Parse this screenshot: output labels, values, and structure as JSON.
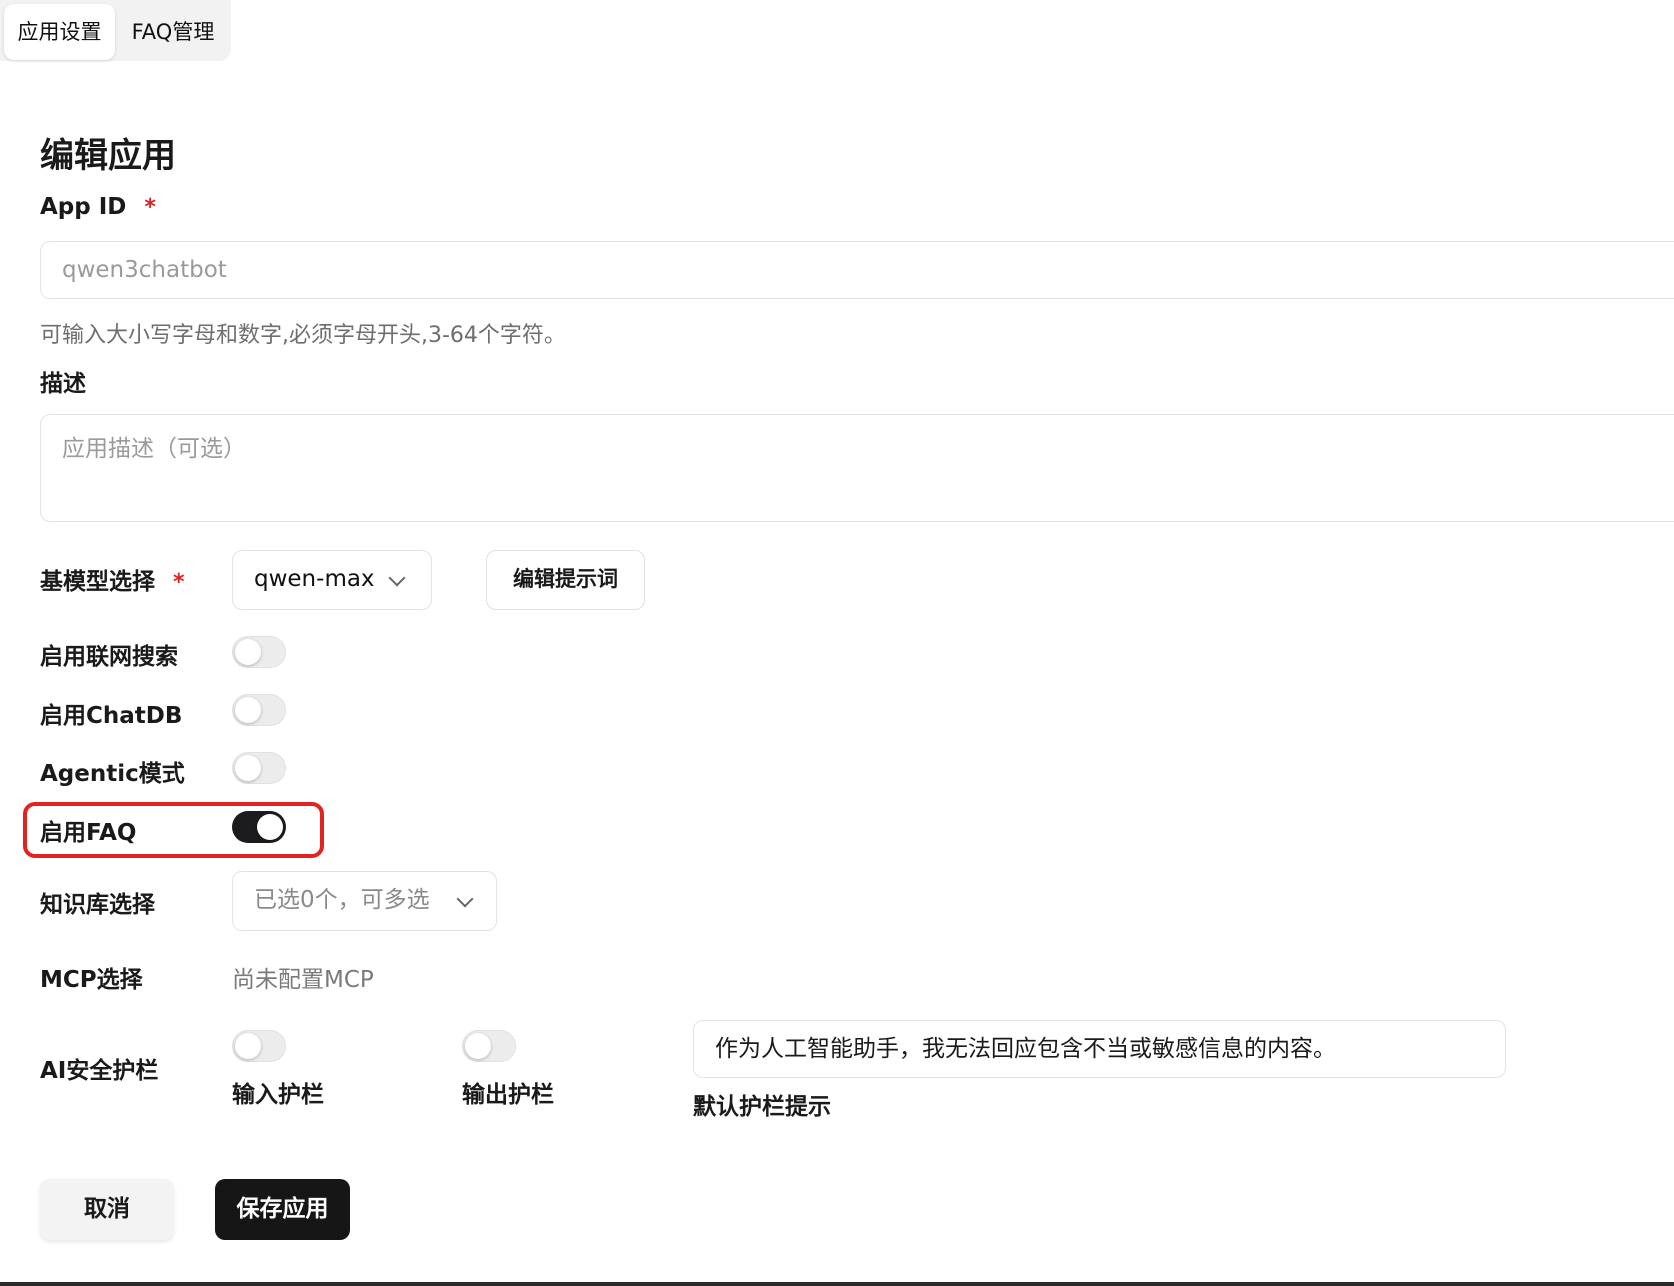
{
  "tabs": [
    {
      "label": "应用设置",
      "active": true
    },
    {
      "label": "FAQ管理",
      "active": false
    }
  ],
  "page_title": "编辑应用",
  "app_id": {
    "label": "App ID",
    "required_mark": "*",
    "value": "qwen3chatbot",
    "hint": "可输入大小写字母和数字,必须字母开头,3-64个字符。"
  },
  "description": {
    "label": "描述",
    "placeholder": "应用描述（可选）"
  },
  "model": {
    "label": "基模型选择",
    "required_mark": "*",
    "selected": "qwen-max",
    "edit_prompt_label": "编辑提示词"
  },
  "toggles": {
    "web_search": {
      "label": "启用联网搜索",
      "on": false
    },
    "chatdb": {
      "label": "启用ChatDB",
      "on": false
    },
    "agentic": {
      "label": "Agentic模式",
      "on": false
    },
    "faq": {
      "label": "启用FAQ",
      "on": true
    }
  },
  "knowledge_base": {
    "label": "知识库选择",
    "placeholder": "已选0个，可多选"
  },
  "mcp": {
    "label": "MCP选择",
    "value": "尚未配置MCP"
  },
  "guardrail": {
    "label": "AI安全护栏",
    "input_label": "输入护栏",
    "input_on": false,
    "output_label": "输出护栏",
    "output_on": false,
    "default_text": "作为人工智能助手，我无法回应包含不当或敏感信息的内容。",
    "default_label": "默认护栏提示"
  },
  "actions": {
    "cancel_label": "取消",
    "save_label": "保存应用"
  },
  "colors": {
    "accent_dark": "#161616",
    "required": "#e02020",
    "highlight_border": "#e32222"
  }
}
